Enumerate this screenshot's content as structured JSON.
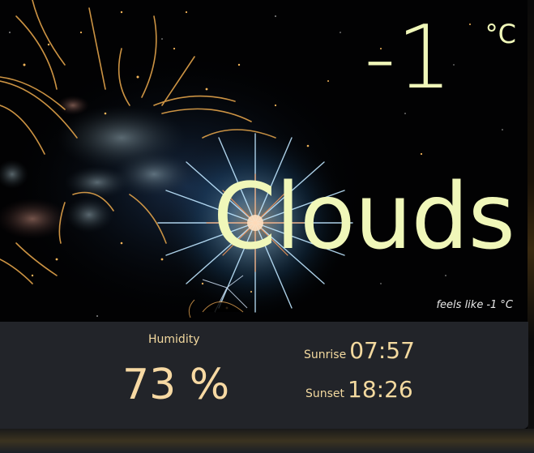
{
  "weather": {
    "temperature": "-1",
    "unit": "°C",
    "condition": "Clouds",
    "feels_like_label": "feels like",
    "feels_like_value": "-1 °C"
  },
  "details": {
    "humidity_label": "Humidity",
    "humidity_value": "73 %",
    "sunrise_label": "Sunrise",
    "sunrise_value": "07:57",
    "sunset_label": "Sunset",
    "sunset_value": "18:26"
  },
  "colors": {
    "primary_text": "#f0f7b9",
    "detail_text": "#f3d99f",
    "panel_bg": "#222429",
    "background": "#000000"
  },
  "background_image": "fireworks-night-sky"
}
